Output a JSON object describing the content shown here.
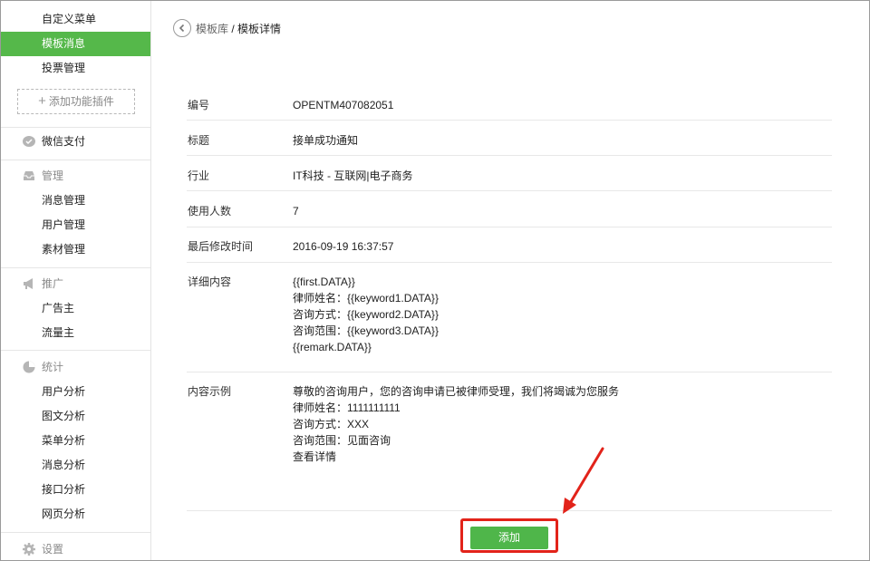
{
  "sidebar": {
    "top_items": [
      "自定义菜单",
      "模板消息",
      "投票管理"
    ],
    "active_item": "模板消息",
    "add_plugin": "添加功能插件",
    "wechat_pay": "微信支付",
    "sections": {
      "manage": {
        "title": "管理",
        "items": [
          "消息管理",
          "用户管理",
          "素材管理"
        ]
      },
      "promote": {
        "title": "推广",
        "items": [
          "广告主",
          "流量主"
        ]
      },
      "stats": {
        "title": "统计",
        "items": [
          "用户分析",
          "图文分析",
          "菜单分析",
          "消息分析",
          "接口分析",
          "网页分析"
        ]
      },
      "settings": {
        "title": "设置"
      }
    }
  },
  "breadcrumb": {
    "parent": "模板库",
    "separator": " / ",
    "current": "模板详情"
  },
  "detail": {
    "number": {
      "label": "编号",
      "value": "OPENTM407082051"
    },
    "title": {
      "label": "标题",
      "value": "接单成功通知"
    },
    "industry": {
      "label": "行业",
      "value": "IT科技 - 互联网|电子商务"
    },
    "users": {
      "label": "使用人数",
      "value": "7"
    },
    "modified": {
      "label": "最后修改时间",
      "value": "2016-09-19 16:37:57"
    },
    "content": {
      "label": "详细内容",
      "lines": [
        "{{first.DATA}}",
        "律师姓名：{{keyword1.DATA}}",
        "咨询方式：{{keyword2.DATA}}",
        "咨询范围：{{keyword3.DATA}}",
        "{{remark.DATA}}"
      ]
    },
    "example": {
      "label": "内容示例",
      "lines": [
        "尊敬的咨询用户，您的咨询申请已被律师受理，我们将竭诚为您服务",
        "律师姓名：1111111111",
        "咨询方式：XXX",
        "咨询范围：见面咨询",
        "查看详情"
      ]
    }
  },
  "actions": {
    "add_label": "添加"
  },
  "colors": {
    "accent_green": "#55b84a",
    "annotation_red": "#e2231a"
  }
}
